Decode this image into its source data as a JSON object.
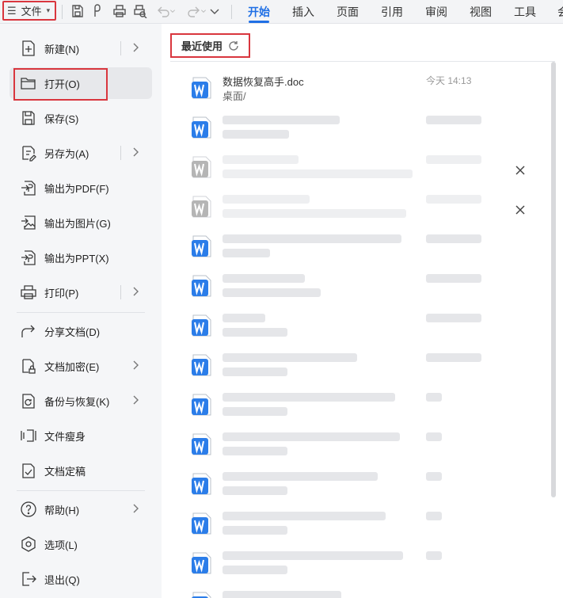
{
  "topbar": {
    "file_menu": {
      "label": "文件",
      "hamburger": "☰",
      "dropdown": "▾"
    },
    "toolbar_icons": [
      "save-icon",
      "export-icon",
      "print-icon",
      "print-preview-icon",
      "undo-icon",
      "redo-icon",
      "more-icon"
    ],
    "tabs": [
      {
        "label": "开始",
        "active": true
      },
      {
        "label": "插入",
        "active": false
      },
      {
        "label": "页面",
        "active": false
      },
      {
        "label": "引用",
        "active": false
      },
      {
        "label": "审阅",
        "active": false
      },
      {
        "label": "视图",
        "active": false
      },
      {
        "label": "工具",
        "active": false
      },
      {
        "label": "会",
        "active": false
      }
    ]
  },
  "menu": {
    "items": [
      {
        "label": "新建(N)",
        "icon": "new-document-icon",
        "submenu": true
      },
      {
        "label": "打开(O)",
        "icon": "open-folder-icon",
        "submenu": false,
        "selected": true
      },
      {
        "label": "保存(S)",
        "icon": "save-icon",
        "submenu": false
      },
      {
        "label": "另存为(A)",
        "icon": "save-as-icon",
        "submenu": true
      },
      {
        "label": "输出为PDF(F)",
        "icon": "export-pdf-icon",
        "submenu": false
      },
      {
        "label": "输出为图片(G)",
        "icon": "export-image-icon",
        "submenu": false
      },
      {
        "label": "输出为PPT(X)",
        "icon": "export-ppt-icon",
        "submenu": false
      },
      {
        "label": "打印(P)",
        "icon": "print-icon",
        "submenu": true
      },
      {
        "label": "分享文档(D)",
        "icon": "share-icon",
        "submenu": false
      },
      {
        "label": "文档加密(E)",
        "icon": "encrypt-icon",
        "submenu": true
      },
      {
        "label": "备份与恢复(K)",
        "icon": "backup-icon",
        "submenu": true
      },
      {
        "label": "文件瘦身",
        "icon": "slim-file-icon",
        "submenu": false
      },
      {
        "label": "文档定稿",
        "icon": "finalize-icon",
        "submenu": false
      },
      {
        "label": "帮助(H)",
        "icon": "help-icon",
        "submenu": true
      },
      {
        "label": "选项(L)",
        "icon": "options-icon",
        "submenu": false
      },
      {
        "label": "退出(Q)",
        "icon": "exit-icon",
        "submenu": false
      }
    ]
  },
  "recent": {
    "title": "最近使用",
    "files": [
      {
        "name": "数据恢复高手.doc",
        "path": "桌面/",
        "time": "今天 14:13",
        "blurred": false,
        "removable": false,
        "icon_color": "#2b7de9"
      },
      {
        "blurred": true,
        "removable": false,
        "icon_color": "#2b7de9"
      },
      {
        "blurred": true,
        "removable": true,
        "icon_color": "#b5b5b5"
      },
      {
        "blurred": true,
        "removable": true,
        "icon_color": "#b5b5b5"
      },
      {
        "blurred": true,
        "removable": false,
        "icon_color": "#2b7de9"
      },
      {
        "blurred": true,
        "removable": false,
        "icon_color": "#2b7de9"
      },
      {
        "blurred": true,
        "removable": false,
        "icon_color": "#2b7de9"
      },
      {
        "blurred": true,
        "removable": false,
        "icon_color": "#2b7de9"
      },
      {
        "blurred": true,
        "removable": false,
        "icon_color": "#2b7de9"
      },
      {
        "blurred": true,
        "removable": false,
        "icon_color": "#2b7de9"
      },
      {
        "blurred": true,
        "removable": false,
        "icon_color": "#2b7de9"
      },
      {
        "blurred": true,
        "removable": false,
        "icon_color": "#2b7de9"
      },
      {
        "blurred": true,
        "removable": false,
        "icon_color": "#2b7de9"
      }
    ]
  },
  "colors": {
    "accent": "#1f6fe5",
    "highlight_red": "#d9363e",
    "word_blue": "#2b7de9",
    "disabled_gray": "#b5b5b5"
  }
}
